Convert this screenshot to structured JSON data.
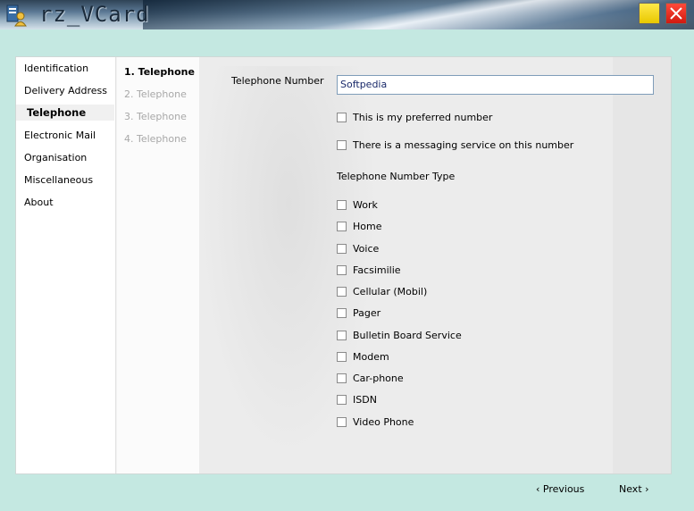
{
  "window": {
    "title": "rz_VCard",
    "app_icon": "vcard-app-icon",
    "minimize_icon": "minimize-icon",
    "close_icon": "close-icon"
  },
  "sidebar": {
    "items": [
      {
        "label": "Identification"
      },
      {
        "label": "Delivery Address"
      },
      {
        "label": "Telephone",
        "selected": true
      },
      {
        "label": "Electronic Mail"
      },
      {
        "label": "Organisation"
      },
      {
        "label": "Miscellaneous"
      },
      {
        "label": "About"
      }
    ]
  },
  "steps": {
    "items": [
      {
        "label": "1. Telephone",
        "active": true
      },
      {
        "label": "2. Telephone"
      },
      {
        "label": "3. Telephone"
      },
      {
        "label": "4. Telephone"
      }
    ]
  },
  "form": {
    "telephone_number_label": "Telephone Number",
    "telephone_number_value": "Softpedia",
    "preferred_label": "This is my preferred number",
    "messaging_label": "There is a messaging service on this number",
    "type_heading": "Telephone Number Type",
    "types": [
      {
        "label": "Work",
        "checked": false
      },
      {
        "label": "Home",
        "checked": false
      },
      {
        "label": "Voice",
        "checked": false
      },
      {
        "label": "Facsimilie",
        "checked": false
      },
      {
        "label": "Cellular (Mobil)",
        "checked": false
      },
      {
        "label": "Pager",
        "checked": false
      },
      {
        "label": "Bulletin Board Service",
        "checked": false
      },
      {
        "label": "Modem",
        "checked": false
      },
      {
        "label": "Car-phone",
        "checked": false
      },
      {
        "label": "ISDN",
        "checked": false
      },
      {
        "label": "Video Phone",
        "checked": false
      }
    ]
  },
  "footer": {
    "previous_label": "‹  Previous",
    "next_label": "Next  ›"
  }
}
